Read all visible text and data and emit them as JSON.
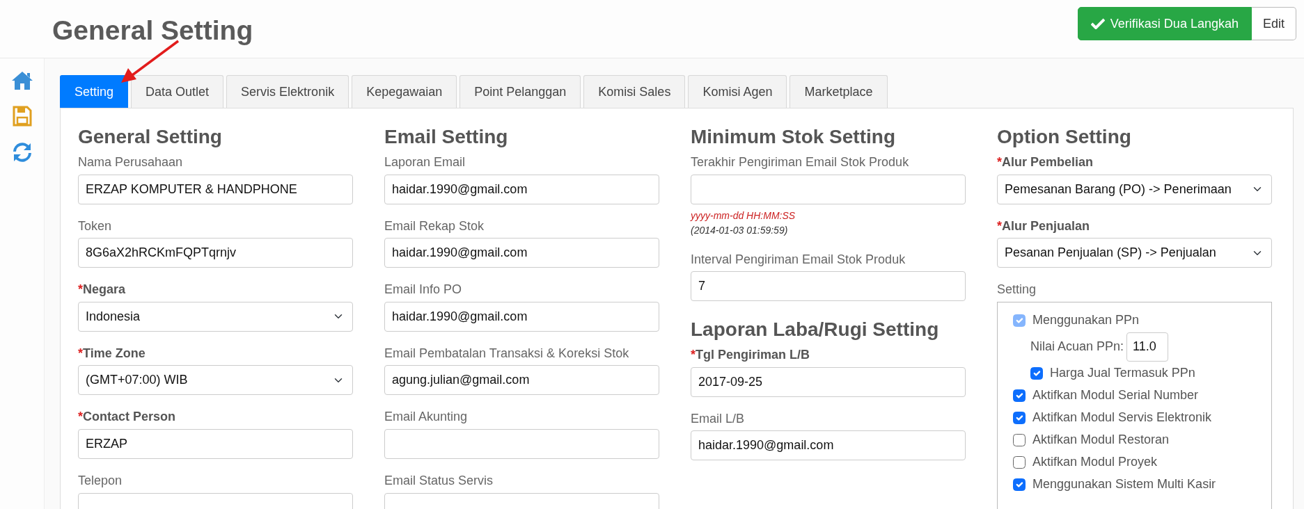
{
  "page_title": "General Setting",
  "header_buttons": [
    {
      "label": "Verifikasi Dua Langkah",
      "kind": "success"
    },
    {
      "label": "Edit",
      "kind": "plain"
    }
  ],
  "tabs": [
    {
      "label": "Setting",
      "selected": true
    },
    {
      "label": "Data Outlet",
      "selected": false
    },
    {
      "label": "Servis Elektronik",
      "selected": false
    },
    {
      "label": "Kepegawaian",
      "selected": false
    },
    {
      "label": "Point Pelanggan",
      "selected": false
    },
    {
      "label": "Komisi Sales",
      "selected": false
    },
    {
      "label": "Komisi Agen",
      "selected": false
    },
    {
      "label": "Marketplace",
      "selected": false
    }
  ],
  "columns": [
    {
      "sections": [
        {
          "heading": "General Setting",
          "fields": [
            {
              "label": "Nama Perusahaan",
              "kind": "text",
              "value": "ERZAP KOMPUTER & HANDPHONE"
            },
            {
              "label": "Token",
              "kind": "text",
              "value": "8G6aX2hRCKmFQPTqrnjv"
            },
            {
              "label": "Negara",
              "required_mark": "*",
              "kind": "select",
              "value": "Indonesia"
            },
            {
              "label": "Time Zone",
              "required_mark": "*",
              "kind": "select",
              "value": "(GMT+07:00) WIB"
            },
            {
              "label": "Contact Person",
              "required_mark": "*",
              "kind": "text",
              "value": "ERZAP"
            },
            {
              "label": "Telepon",
              "kind": "text"
            }
          ]
        }
      ]
    },
    {
      "sections": [
        {
          "heading": "Email Setting",
          "fields": [
            {
              "label": "Laporan Email",
              "kind": "text",
              "value": "haidar.1990@gmail.com"
            },
            {
              "label": "Email Rekap Stok",
              "kind": "text",
              "value": "haidar.1990@gmail.com"
            },
            {
              "label": "Email Info PO",
              "kind": "text",
              "value": "haidar.1990@gmail.com"
            },
            {
              "label": "Email Pembatalan Transaksi & Koreksi Stok",
              "kind": "text",
              "value": "agung.julian@gmail.com"
            },
            {
              "label": "Email Akunting",
              "kind": "text"
            },
            {
              "label": "Email Status Servis",
              "kind": "text"
            }
          ]
        }
      ]
    },
    {
      "sections": [
        {
          "heading": "Minimum Stok Setting",
          "fields": [
            {
              "label": "Terakhir Pengiriman Email Stok Produk",
              "kind": "text",
              "hint": "yyyy-mm-dd HH:MM:SS",
              "example": "(2014-01-03 01:59:59)"
            },
            {
              "label": "Interval Pengiriman Email Stok Produk",
              "kind": "text",
              "value": "7"
            }
          ]
        },
        {
          "heading": "Laporan Laba/Rugi Setting",
          "fields": [
            {
              "label": "Tgl Pengiriman L/B",
              "required_mark": "*",
              "kind": "text",
              "value": "2017-09-25"
            },
            {
              "label": "Email L/B",
              "kind": "text",
              "value": "haidar.1990@gmail.com"
            }
          ]
        }
      ]
    },
    {
      "sections": [
        {
          "heading": "Option Setting",
          "fields": [
            {
              "label": "Alur Pembelian",
              "required_mark": "*",
              "kind": "select",
              "value": "Pemesanan Barang (PO) -> Penerimaan"
            },
            {
              "label": "Alur Penjualan",
              "required_mark": "*",
              "kind": "select",
              "value": "Pesanan Penjualan (SP) -> Penjualan"
            },
            {
              "label": "Setting",
              "kind": "options",
              "items": [
                {
                  "kind": "checkbox",
                  "label": "Menggunakan PPn",
                  "checked": true,
                  "disabled": true,
                  "children": [
                    {
                      "kind": "number",
                      "label": "Nilai Acuan PPn:",
                      "value": "11.0"
                    },
                    {
                      "kind": "checkbox",
                      "label": "Harga Jual Termasuk PPn",
                      "checked": true,
                      "disabled": false
                    }
                  ]
                },
                {
                  "kind": "checkbox",
                  "label": "Aktifkan Modul Serial Number",
                  "checked": true,
                  "disabled": false
                },
                {
                  "kind": "checkbox",
                  "label": "Aktifkan Modul Servis Elektronik",
                  "checked": true,
                  "disabled": false
                },
                {
                  "kind": "checkbox",
                  "label": "Aktifkan Modul Restoran",
                  "checked": false,
                  "disabled": false
                },
                {
                  "kind": "checkbox",
                  "label": "Aktifkan Modul Proyek",
                  "checked": false,
                  "disabled": false
                },
                {
                  "kind": "checkbox",
                  "label": "Menggunakan Sistem Multi Kasir",
                  "checked": true,
                  "disabled": false
                }
              ]
            }
          ]
        }
      ]
    }
  ]
}
